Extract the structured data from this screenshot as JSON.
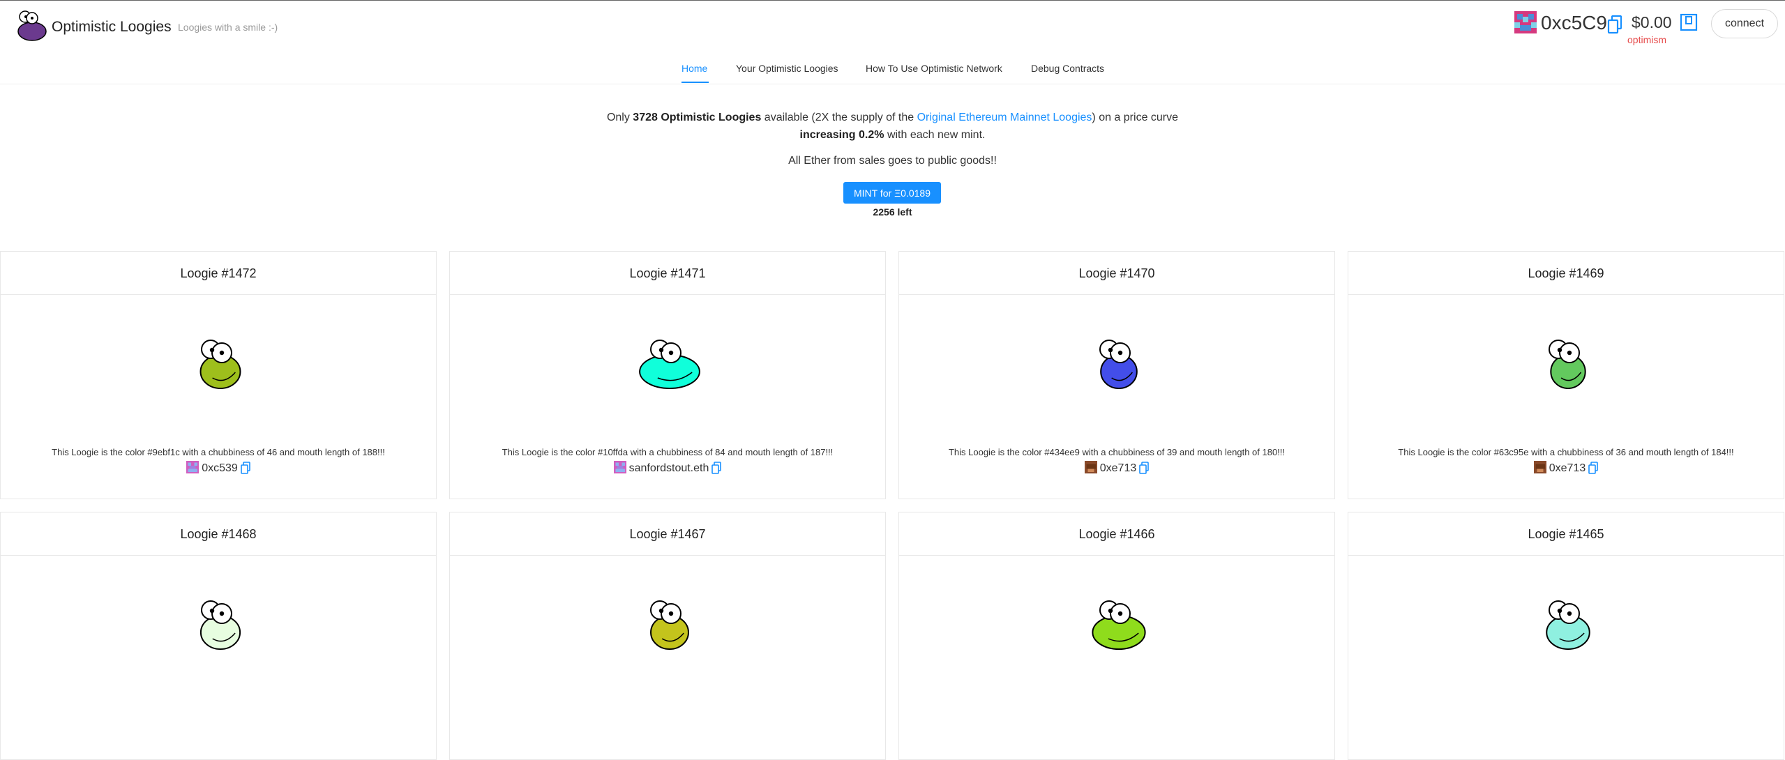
{
  "app": {
    "title": "Optimistic Loogies",
    "subtitle": "Loogies with a smile :-)"
  },
  "account": {
    "address": "0xc5C9",
    "balance": "$0.00",
    "network": "optimism",
    "connect_label": "connect"
  },
  "nav": {
    "items": [
      {
        "label": "Home",
        "active": true
      },
      {
        "label": "Your Optimistic Loogies"
      },
      {
        "label": "How To Use Optimistic Network"
      },
      {
        "label": "Debug Contracts"
      }
    ]
  },
  "intro": {
    "only": "Only ",
    "count_bold": "3728 Optimistic Loogies",
    "available": " available (2X the supply of the ",
    "link": "Original Ethereum Mainnet Loogies",
    "curve": ") on a price curve",
    "increasing_bold": "increasing 0.2%",
    "each_mint": " with each new mint.",
    "public_goods": "All Ether from sales goes to public goods!!"
  },
  "mint": {
    "label": "MINT for Ξ0.0189",
    "left": "2256 left"
  },
  "loogies": [
    {
      "title": "Loogie #1472",
      "desc": "This Loogie is the color #9ebf1c with a chubbiness of 46 and mouth length of 188!!!",
      "owner": "0xc539",
      "color": "#9ebf1c",
      "chubbiness": 46
    },
    {
      "title": "Loogie #1471",
      "desc": "This Loogie is the color #10ffda with a chubbiness of 84 and mouth length of 187!!!",
      "owner": "sanfordstout.eth",
      "color": "#10ffda",
      "chubbiness": 84
    },
    {
      "title": "Loogie #1470",
      "desc": "This Loogie is the color #434ee9 with a chubbiness of 39 and mouth length of 180!!!",
      "owner": "0xe713",
      "color": "#434ee9",
      "chubbiness": 39
    },
    {
      "title": "Loogie #1469",
      "desc": "This Loogie is the color #63c95e with a chubbiness of 36 and mouth length of 184!!!",
      "owner": "0xe713",
      "color": "#63c95e",
      "chubbiness": 36
    },
    {
      "title": "Loogie #1468",
      "color": "#e7fde0",
      "chubbiness": 45
    },
    {
      "title": "Loogie #1467",
      "color": "#c4c41c",
      "chubbiness": 42
    },
    {
      "title": "Loogie #1466",
      "color": "#8fdc1c",
      "chubbiness": 70
    },
    {
      "title": "Loogie #1465",
      "color": "#8ff0e0",
      "chubbiness": 52
    }
  ],
  "colors": {
    "accent": "#1890ff",
    "network": "#e64b4b"
  }
}
